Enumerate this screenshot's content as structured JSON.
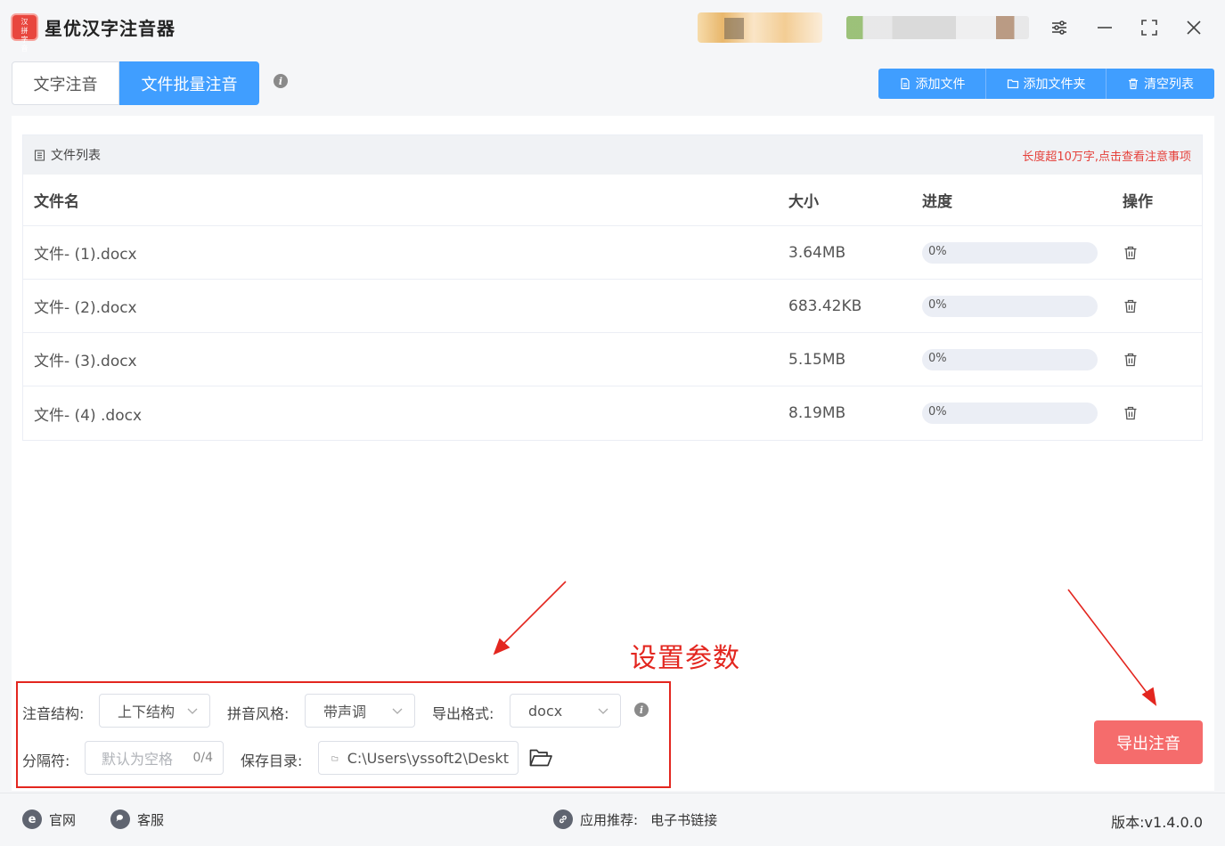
{
  "window": {
    "title": "星优汉字注音器",
    "logo_chars": [
      "汉",
      "拼",
      "字",
      "音"
    ]
  },
  "tabs": [
    {
      "label": "文字注音",
      "active": false
    },
    {
      "label": "文件批量注音",
      "active": true
    }
  ],
  "toolbar": {
    "add_file": "添加文件",
    "add_folder": "添加文件夹",
    "clear_list": "清空列表"
  },
  "file_list": {
    "title": "文件列表",
    "tip": "长度超10万字,点击查看注意事项",
    "headers": {
      "name": "文件名",
      "size": "大小",
      "progress": "进度",
      "action": "操作"
    },
    "rows": [
      {
        "name": "文件- (1).docx",
        "size": "3.64MB",
        "progress": "0%",
        "progress_value": 0
      },
      {
        "name": "文件- (2).docx",
        "size": "683.42KB",
        "progress": "0%",
        "progress_value": 0
      },
      {
        "name": "文件- (3).docx",
        "size": "5.15MB",
        "progress": "0%",
        "progress_value": 0
      },
      {
        "name": "文件- (4) .docx",
        "size": "8.19MB",
        "progress": "0%",
        "progress_value": 0
      }
    ]
  },
  "annotation": {
    "label": "设置参数",
    "color": "#e3261f"
  },
  "settings": {
    "structure_label": "注音结构:",
    "structure_value": "上下结构",
    "style_label": "拼音风格:",
    "style_value": "带声调",
    "format_label": "导出格式:",
    "format_value": "docx",
    "separator_label": "分隔符:",
    "separator_placeholder": "默认为空格",
    "separator_count": "0/4",
    "save_dir_label": "保存目录:",
    "save_dir_value": "C:\\Users\\yssoft2\\Deskt"
  },
  "export_button": "导出注音",
  "footer": {
    "website": "官网",
    "support": "客服",
    "recommend_label": "应用推荐:",
    "recommend_link": "电子书链接",
    "version": "版本:v1.4.0.0"
  },
  "colors": {
    "primary": "#409eff",
    "danger": "#f56c6c",
    "tip": "#e5403a"
  }
}
